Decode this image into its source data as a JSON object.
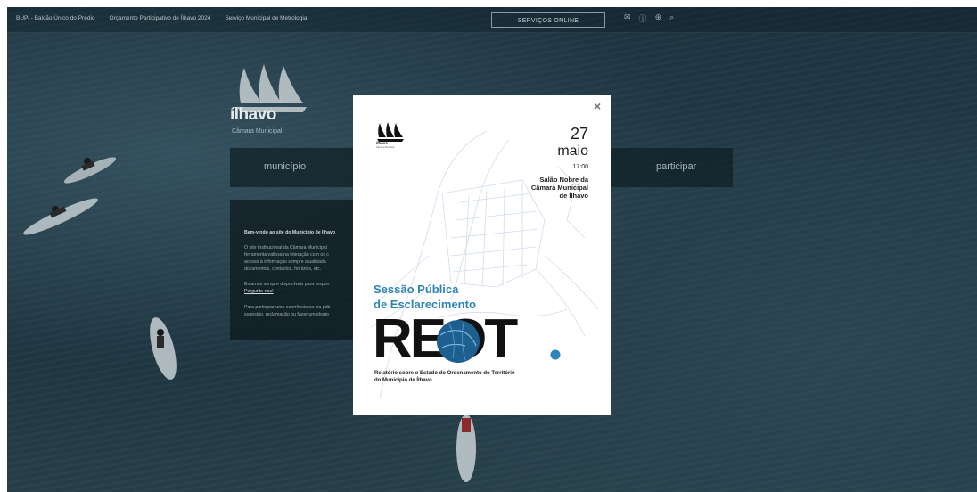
{
  "topbar": {
    "links": [
      "BUPi - Balcão Único do Prédio",
      "Orçamento Participativo de Ílhavo 2024",
      "Serviço Municipal de Metrologia"
    ],
    "services_button": "SERVIÇOS ONLINE",
    "icons": [
      "mail-icon",
      "info-icon",
      "globe-icon",
      "search-icon"
    ]
  },
  "logo": {
    "word": "ílhavo",
    "subtitle": "Câmara Municipal"
  },
  "nav": {
    "municipio": "município",
    "participar": "participar"
  },
  "welcome": {
    "title": "Bem-vindo ao site do Município de Ílhavo",
    "lines": [
      "O site Institucional da Câmara Municipal",
      "ferramenta valiosa na interação com os c",
      "acesso à informação sempre atualizada",
      "documentos, contactos, horários, etc.",
      "Estamos sempre disponíveis para respon",
      "Pergunte-nos!",
      "Para participar uma ocorrência na via púb",
      "sugestão, reclamação ou fazer um elogio"
    ]
  },
  "modal": {
    "close": "×",
    "logo_word": "ílhavo",
    "logo_sub": "Câmara Municipal",
    "day": "27",
    "month": "maio",
    "time": "17:00",
    "venue": [
      "Salão Nobre da",
      "Câmara Municipal",
      "de Ílhavo"
    ],
    "session_line1": "Sessão Pública",
    "session_line2": "de Esclarecimento",
    "acronym": "REOT",
    "report_line1": "Relatório sobre o Estado do Ordenamento do Território",
    "report_line2": "do Município de Ílhavo",
    "accent_color": "#2d84b8"
  }
}
